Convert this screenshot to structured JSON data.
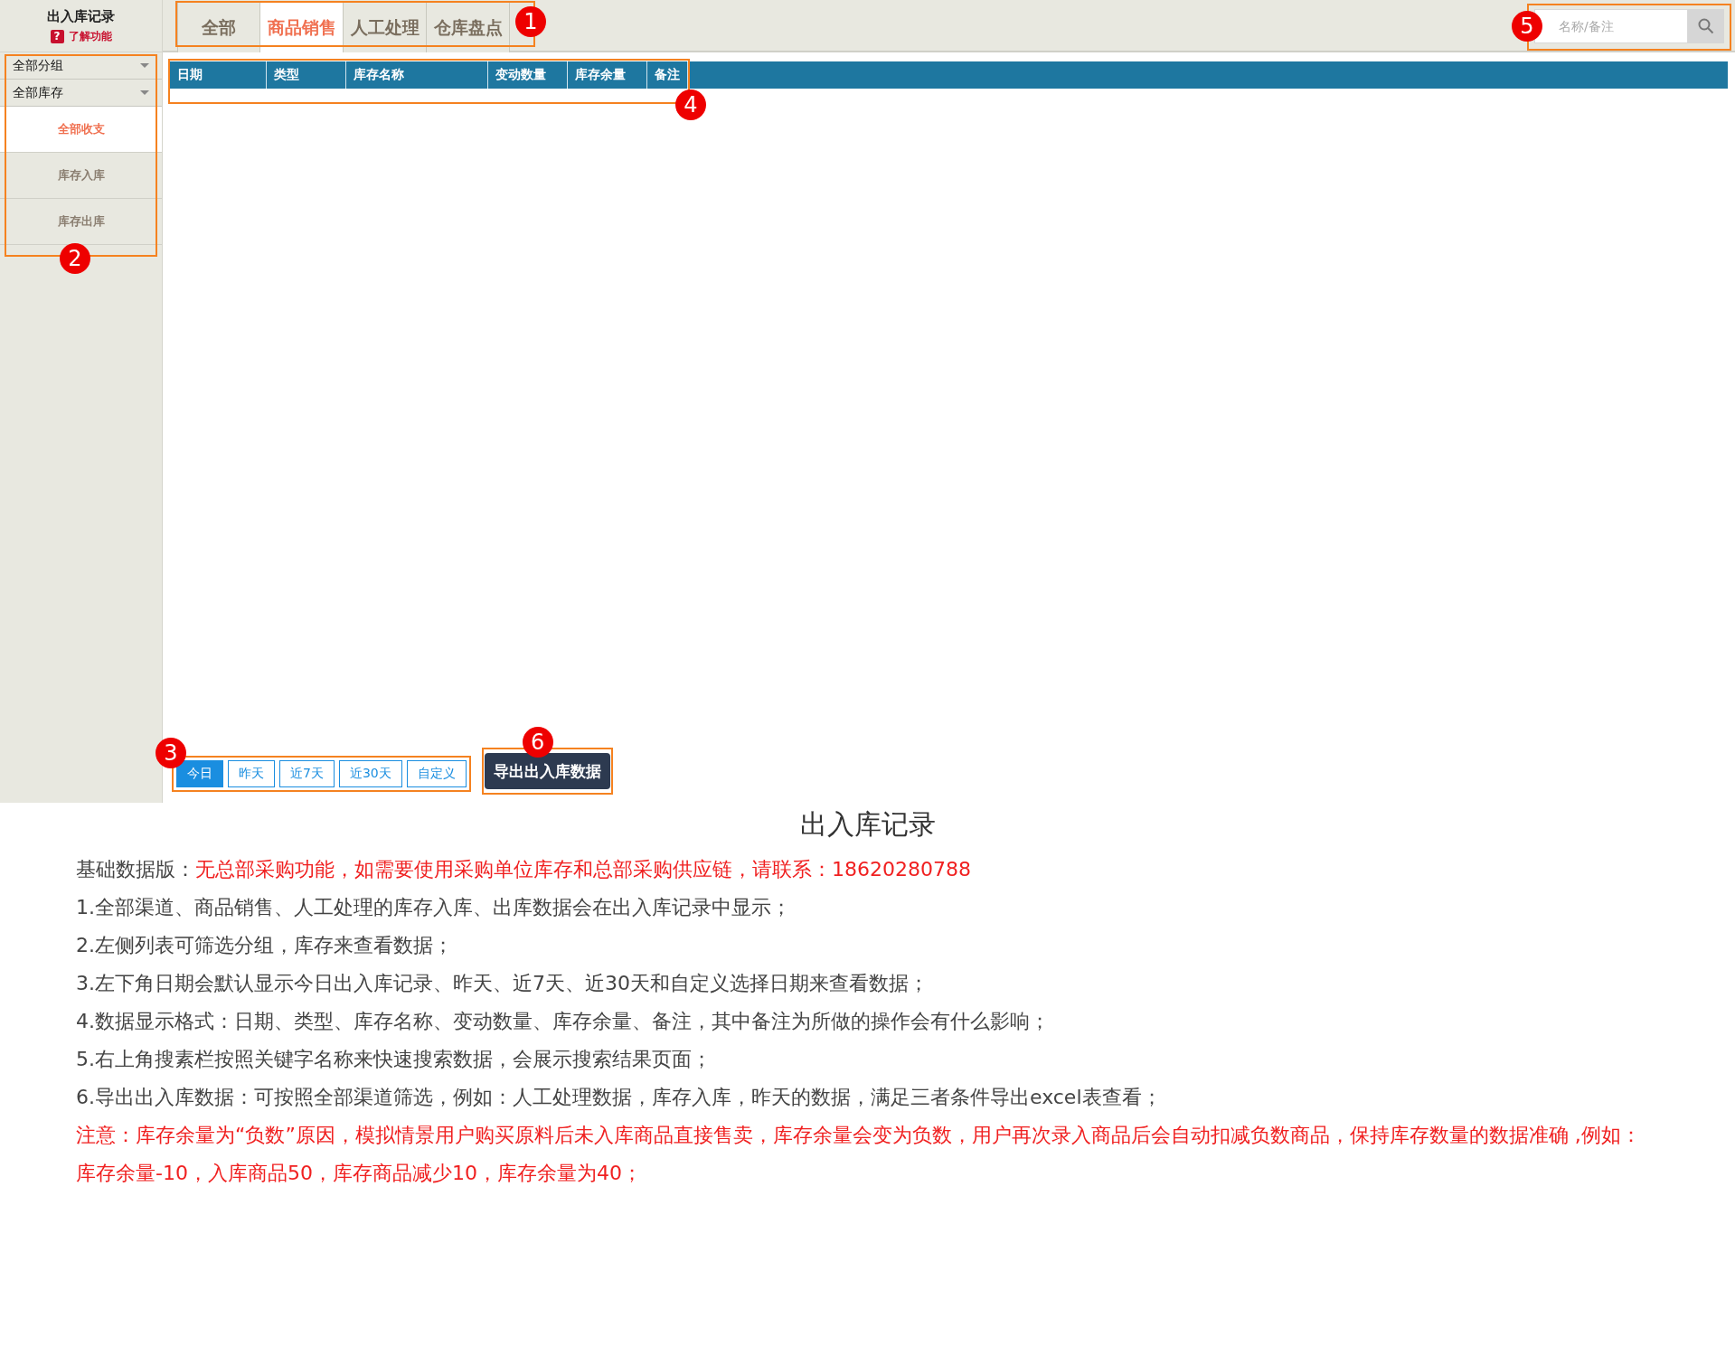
{
  "app": {
    "title": "出入库记录",
    "help_icon": "?",
    "help_link": "了解功能"
  },
  "tabs": {
    "callout": "1",
    "items": [
      {
        "label": "全部",
        "selected": false
      },
      {
        "label": "商品销售",
        "selected": true
      },
      {
        "label": "人工处理",
        "selected": false
      },
      {
        "label": "仓库盘点",
        "selected": false
      }
    ]
  },
  "search": {
    "callout": "5",
    "placeholder": "名称/备注"
  },
  "sidebar": {
    "callout": "2",
    "filters": [
      {
        "value": "全部分组"
      },
      {
        "value": "全部库存"
      }
    ],
    "items": [
      {
        "label": "全部收支",
        "selected": true
      },
      {
        "label": "库存入库",
        "selected": false
      },
      {
        "label": "库存出库",
        "selected": false
      }
    ]
  },
  "table": {
    "callout": "4",
    "columns": [
      "日期",
      "类型",
      "库存名称",
      "变动数量",
      "库存余量",
      "备注"
    ]
  },
  "date_ranges": {
    "callout": "3",
    "items": [
      {
        "label": "今日",
        "selected": true
      },
      {
        "label": "昨天",
        "selected": false
      },
      {
        "label": "近7天",
        "selected": false
      },
      {
        "label": "近30天",
        "selected": false
      },
      {
        "label": "自定义",
        "selected": false
      }
    ]
  },
  "export_button": {
    "callout": "6",
    "label": "导出出入库数据"
  },
  "doc": {
    "title": "出入库记录",
    "paragraphs": [
      {
        "kind": "edition",
        "label": "基础数据版：",
        "text": "无总部采购功能，如需要使用采购单位库存和总部采购供应链，请联系：18620280788"
      },
      {
        "kind": "plain",
        "text": "1.全部渠道、商品销售、人工处理的库存入库、出库数据会在出入库记录中显示；"
      },
      {
        "kind": "plain",
        "text": "2.左侧列表可筛选分组，库存来查看数据；"
      },
      {
        "kind": "plain",
        "text": "3.左下角日期会默认显示今日出入库记录、昨天、近7天、近30天和自定义选择日期来查看数据；"
      },
      {
        "kind": "plain",
        "text": "4.数据显示格式：日期、类型、库存名称、变动数量、库存余量、备注，其中备注为所做的操作会有什么影响；"
      },
      {
        "kind": "plain",
        "text": "5.右上角搜素栏按照关键字名称来快速搜索数据，会展示搜索结果页面；"
      },
      {
        "kind": "plain",
        "text": "6.导出出入库数据：可按照全部渠道筛选，例如：人工处理数据，库存入库，昨天的数据，满足三者条件导出excel表查看；"
      },
      {
        "kind": "warning",
        "text": "注意：库存余量为“负数”原因，模拟情景用户购买原料后未入库商品直接售卖，库存余量会变为负数，用户再次录入商品后会自动扣减负数商品，保持库存数量的数据准确 ,例如：库存余量-10，入库商品50，库存商品减少10，库存余量为40；"
      }
    ]
  }
}
